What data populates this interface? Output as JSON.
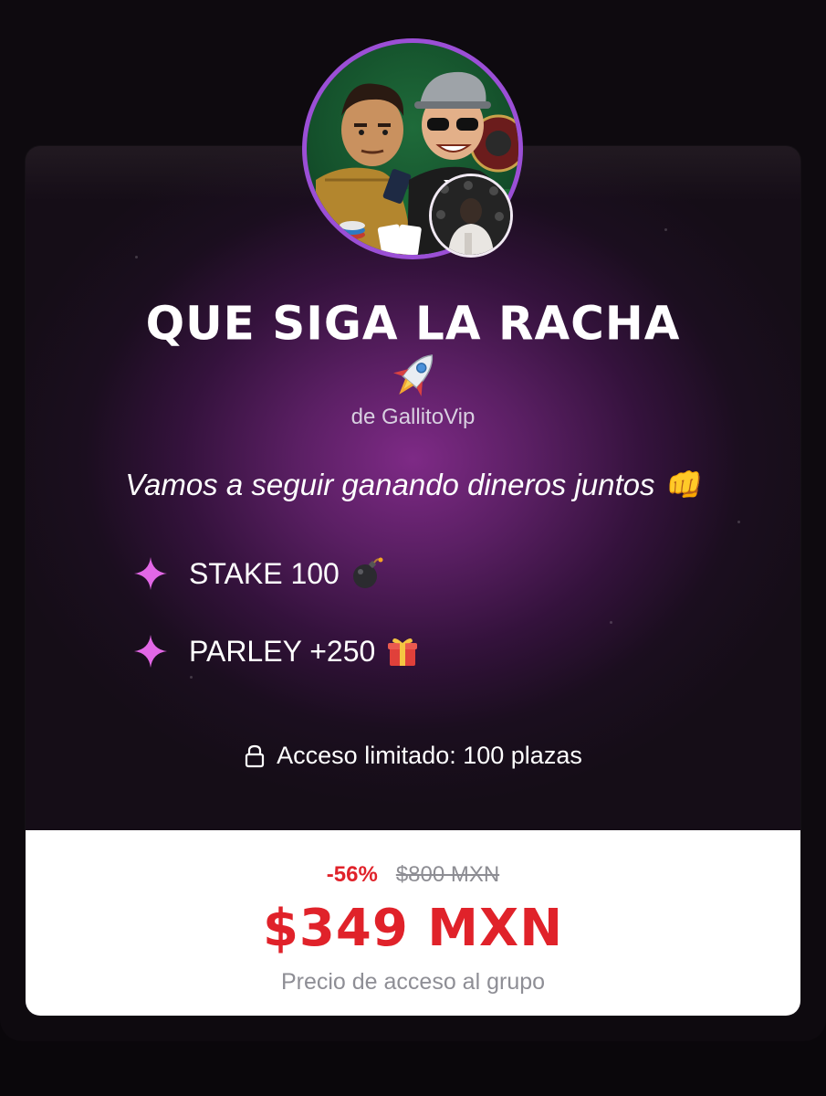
{
  "group": {
    "title": "QUE SIGA LA RACHA",
    "title_emoji_icon": "rocket-icon",
    "author": "de GallitoVip",
    "tagline": "Vamos a seguir ganando dineros juntos 👊"
  },
  "features": [
    {
      "label": "STAKE 100",
      "icon": "bomb-icon"
    },
    {
      "label": "PARLEY +250",
      "icon": "gift-icon"
    }
  ],
  "access": {
    "text": "Acceso limitado: 100 plazas",
    "icon": "lock-icon"
  },
  "pricing": {
    "discount": "-56%",
    "old_price": "$800 MXN",
    "price": "$349 MXN",
    "caption": "Precio de acceso al grupo"
  },
  "colors": {
    "accent_purple": "#9b4fd6",
    "star_pink": "#e267e6",
    "price_red": "#e0222a"
  }
}
